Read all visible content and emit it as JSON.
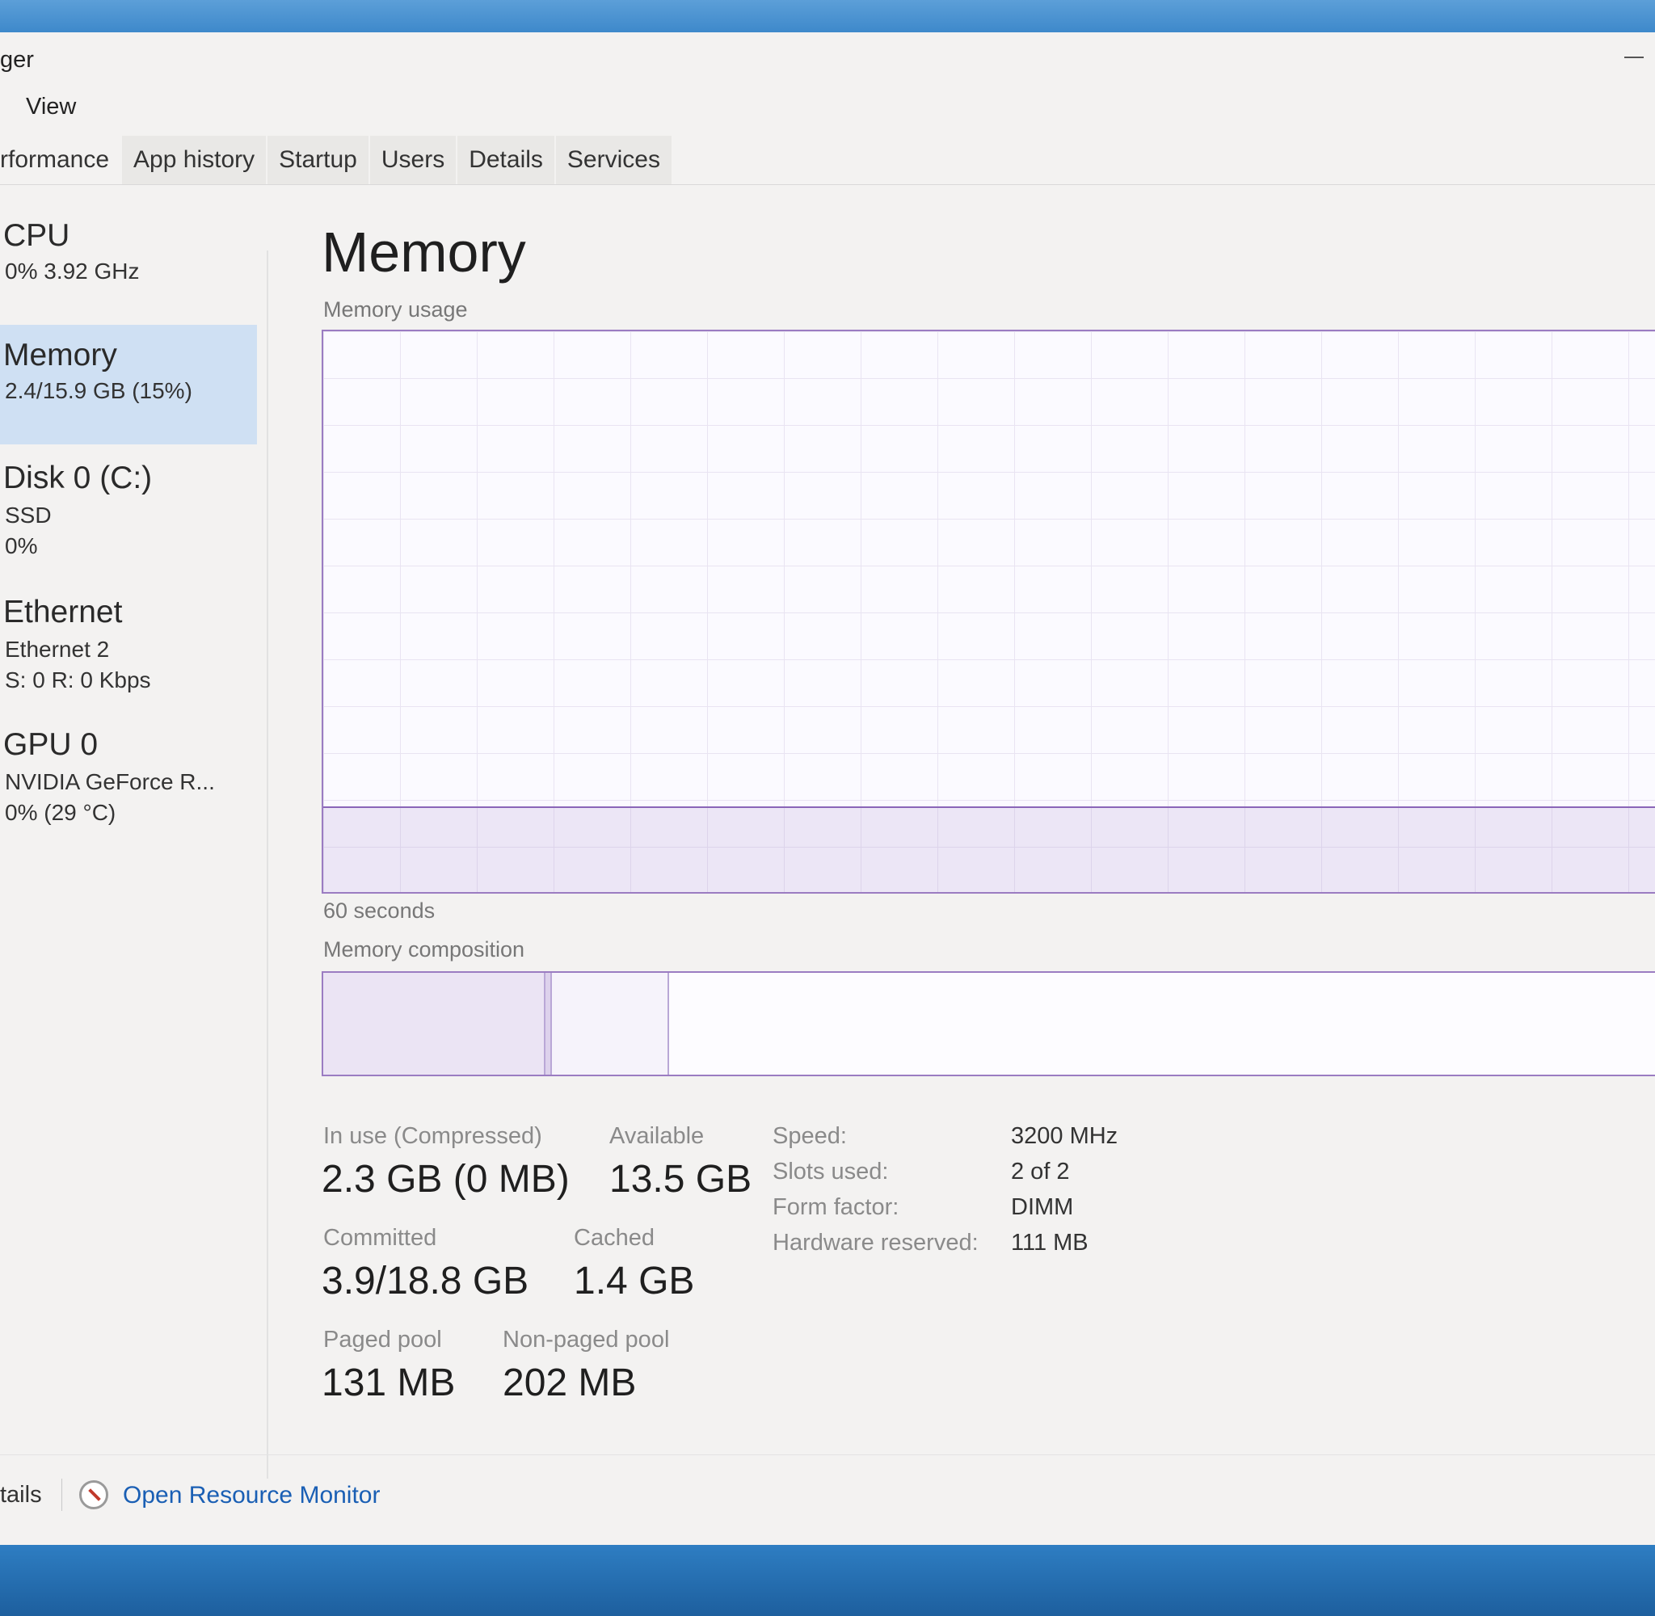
{
  "window": {
    "title_fragment": "ger"
  },
  "menu": {
    "items": [
      "View"
    ]
  },
  "tabs": [
    {
      "label": "rformance",
      "active": true
    },
    {
      "label": "App history"
    },
    {
      "label": "Startup"
    },
    {
      "label": "Users"
    },
    {
      "label": "Details"
    },
    {
      "label": "Services"
    }
  ],
  "sidebar": {
    "items": [
      {
        "title": "CPU",
        "sub1": "0%  3.92 GHz",
        "sub2": ""
      },
      {
        "title": "Memory",
        "sub1": "2.4/15.9 GB (15%)",
        "sub2": "",
        "selected": true
      },
      {
        "title": "Disk 0 (C:)",
        "sub1": "SSD",
        "sub2": "0%"
      },
      {
        "title": "Ethernet",
        "sub1": "Ethernet 2",
        "sub2": "S: 0 R: 0 Kbps"
      },
      {
        "title": "GPU 0",
        "sub1": "NVIDIA GeForce R...",
        "sub2": "0%  (29 °C)"
      }
    ]
  },
  "main": {
    "title": "Memory",
    "usage_graph_label": "Memory usage",
    "usage_graph_time": "60 seconds",
    "usage_fraction": 0.15,
    "composition_label": "Memory composition",
    "stats": {
      "in_use_label": "In use (Compressed)",
      "in_use_value": "2.3 GB (0 MB)",
      "available_label": "Available",
      "available_value": "13.5 GB",
      "committed_label": "Committed",
      "committed_value": "3.9/18.8 GB",
      "cached_label": "Cached",
      "cached_value": "1.4 GB",
      "paged_pool_label": "Paged pool",
      "paged_pool_value": "131 MB",
      "nonpaged_pool_label": "Non-paged pool",
      "nonpaged_pool_value": "202 MB"
    },
    "specs": [
      {
        "label": "Speed:",
        "value": "3200 MHz"
      },
      {
        "label": "Slots used:",
        "value": "2 of 2"
      },
      {
        "label": "Form factor:",
        "value": "DIMM"
      },
      {
        "label": "Hardware reserved:",
        "value": "111 MB"
      }
    ]
  },
  "footer": {
    "left_fragment": "tails",
    "link": "Open Resource Monitor"
  },
  "colors": {
    "accent": "#9b7cc2",
    "selected_bg": "#cfe0f3",
    "link": "#1a5fb4"
  }
}
